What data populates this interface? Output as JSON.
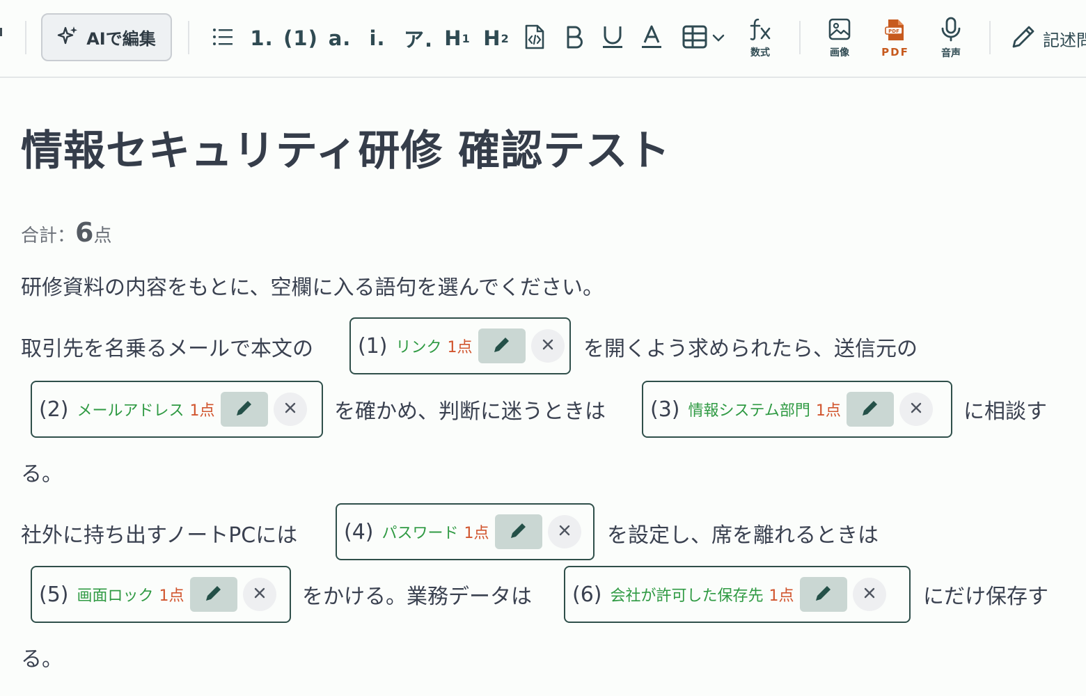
{
  "toolbar": {
    "ai_edit_label": "AIで編集",
    "list_items": [
      "1.",
      "(1)",
      "a.",
      "i.",
      "ア."
    ],
    "h1_main": "H",
    "h1_sub": "1",
    "h2_main": "H",
    "h2_sub": "2",
    "formula_label": "数式",
    "image_label": "画像",
    "pdf_label": "PDF",
    "audio_label": "音声",
    "descriptive_label": "記述問"
  },
  "document": {
    "title": "情報セキュリティ研修 確認テスト",
    "total_prefix": "合計：",
    "total_points": "6",
    "total_suffix": "点",
    "instruction": "研修資料の内容をもとに、空欄に入る語句を選んでください。",
    "segments": {
      "s1": "取引先を名乗るメールで本文の",
      "s2": "を開くよう求められたら、送信元の",
      "s3": "を確かめ、判断に迷うときは",
      "s4": "に相談す",
      "s5": "る。",
      "s6": "社外に持ち出すノートPCには",
      "s7": "を設定し、席を離れるときは",
      "s8": "をかける。業務データは",
      "s9": "にだけ保存す",
      "s10": "る。"
    },
    "blanks": [
      {
        "num": "(1)",
        "answer": "リンク",
        "points": "1点"
      },
      {
        "num": "(2)",
        "answer": "メールアドレス",
        "points": "1点"
      },
      {
        "num": "(3)",
        "answer": "情報システム部門",
        "points": "1点"
      },
      {
        "num": "(4)",
        "answer": "パスワード",
        "points": "1点"
      },
      {
        "num": "(5)",
        "answer": "画面ロック",
        "points": "1点"
      },
      {
        "num": "(6)",
        "answer": "会社が許可した保存先",
        "points": "1点"
      }
    ]
  },
  "colors": {
    "answer_green": "#2f9a43",
    "points_red": "#d1552e",
    "blank_border": "#2f4f4a",
    "pdf_orange": "#c75a1e"
  }
}
